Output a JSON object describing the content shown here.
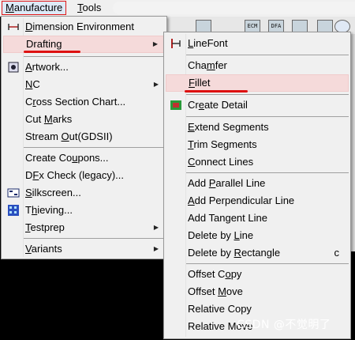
{
  "menubar": {
    "manufacture": "Manufacture",
    "tools": "Tools"
  },
  "main_menu": {
    "items": [
      {
        "label": "Dimension Environment",
        "icon": "dimension-icon"
      },
      {
        "label": "Drafting",
        "has_submenu": true,
        "highlighted": true
      },
      {
        "label": "Artwork...",
        "icon": "artwork-icon"
      },
      {
        "label": "NC",
        "has_submenu": true
      },
      {
        "label": "Cross Section Chart..."
      },
      {
        "label": "Cut Marks"
      },
      {
        "label": "Stream Out(GDSII)"
      },
      {
        "label": "Create Coupons..."
      },
      {
        "label": "DFx Check (legacy)..."
      },
      {
        "label": "Silkscreen...",
        "icon": "silkscreen-icon"
      },
      {
        "label": "Thieving...",
        "icon": "thieving-icon"
      },
      {
        "label": "Testprep",
        "has_submenu": true
      },
      {
        "label": "Variants",
        "has_submenu": true
      }
    ]
  },
  "sub_menu": {
    "items": [
      {
        "label": "LineFont",
        "icon": "linefont-icon"
      },
      {
        "label": "Chamfer"
      },
      {
        "label": "Fillet",
        "highlighted": true
      },
      {
        "label": "Create Detail",
        "icon": "create-detail-icon"
      },
      {
        "label": "Extend Segments"
      },
      {
        "label": "Trim Segments"
      },
      {
        "label": "Connect Lines"
      },
      {
        "label": "Add Parallel Line"
      },
      {
        "label": "Add Perpendicular Line"
      },
      {
        "label": "Add Tangent Line"
      },
      {
        "label": "Delete by Line"
      },
      {
        "label": "Delete by Rectangle",
        "shortcut": "c"
      },
      {
        "label": "Offset Copy"
      },
      {
        "label": "Offset Move"
      },
      {
        "label": "Relative Copy"
      },
      {
        "label": "Relative Move"
      }
    ]
  },
  "toolbar": {
    "icon_labels": [
      "ECM",
      "DFA"
    ]
  },
  "watermark": "CSDN @不觉明了",
  "colors": {
    "highlight": "#f5dada",
    "annotation_red": "#dd1111",
    "menubar_active_border": "#e01818"
  }
}
